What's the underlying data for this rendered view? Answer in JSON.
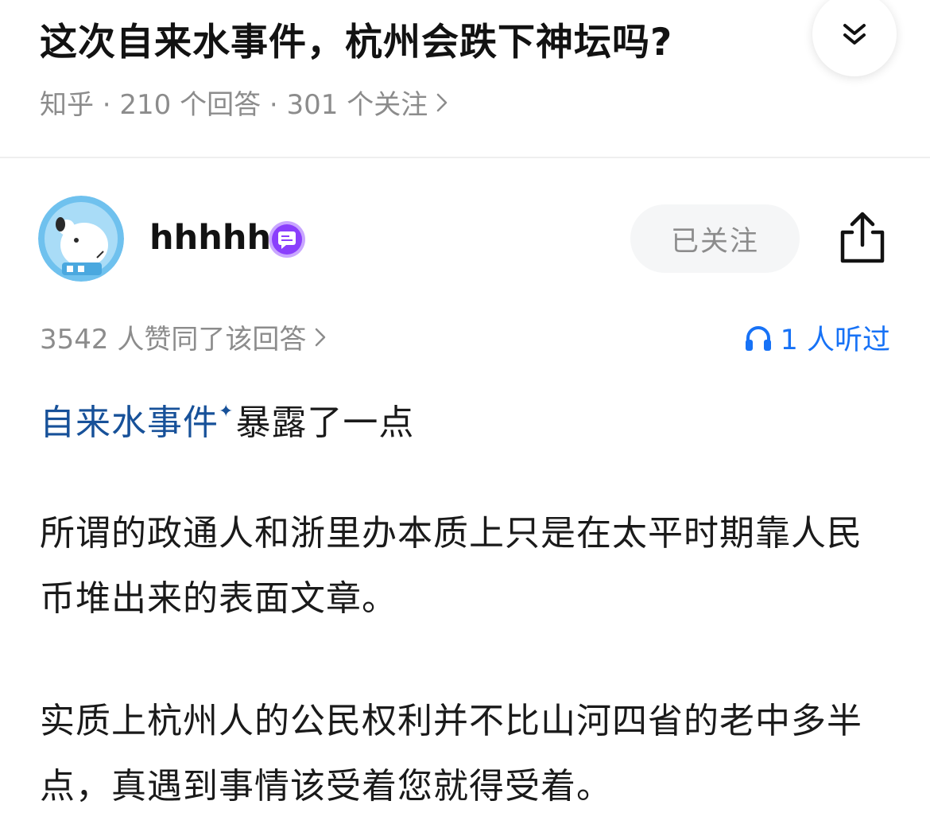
{
  "question": {
    "title": "这次自来水事件，杭州会跌下神坛吗?",
    "meta": "知乎 · 210 个回答 · 301 个关注"
  },
  "header": {
    "collapse_icon": "double-chevron-down-icon"
  },
  "author": {
    "name": "hhhhh",
    "badge_icon": "message-badge-icon",
    "follow_label": "已关注",
    "share_icon": "share-icon"
  },
  "answer": {
    "votes": "3542 人赞同了该回答",
    "listen": "1 人听过",
    "topic_link": "自来水事件",
    "topic_suffix": "暴露了一点",
    "paragraphs": [
      "所谓的政通人和浙里办本质上只是在太平时期靠人民币堆出来的表面文章。",
      "实质上杭州人的公民权利并不比山河四省的老中多半点，真遇到事情该受着您就得受着。"
    ]
  },
  "colors": {
    "accent": "#1772f6",
    "link": "#175199",
    "badge": "#8a3ffc",
    "muted": "#8c8c8c"
  }
}
